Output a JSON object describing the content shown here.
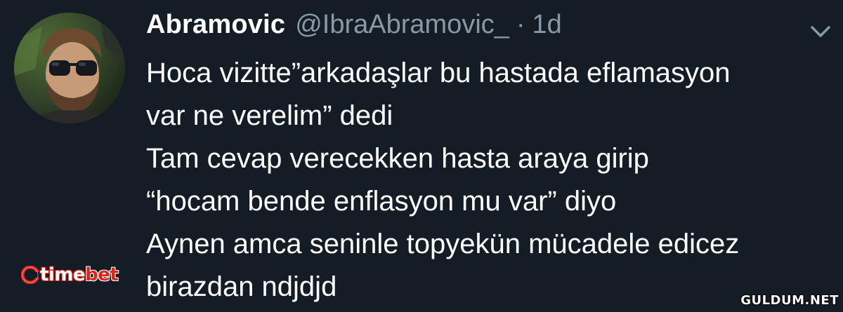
{
  "tweet": {
    "author": {
      "display_name": "Abramovic",
      "handle": "@IbraAbramovic_",
      "separator": "·",
      "time": "1d"
    },
    "lines": [
      "Hoca vizitte”arkadaşlar bu hastada eflamasyon",
      "var ne verelim” dedi",
      "Tam cevap verecekken hasta araya girip",
      "“hocam bende enflasyon mu var” diyo",
      "Aynen amca seninle topyekün mücadele edicez",
      "birazdan ndjdjd"
    ]
  },
  "branding": {
    "logo_part1": "time",
    "logo_part2": "bet",
    "watermark": "GULDUM.NET"
  },
  "colors": {
    "background": "#141d26",
    "text": "#ffffff",
    "muted": "#8899a6",
    "brand_red": "#e2231a"
  },
  "icons": {
    "avatar": "profile-photo",
    "menu": "chevron-down-icon"
  }
}
